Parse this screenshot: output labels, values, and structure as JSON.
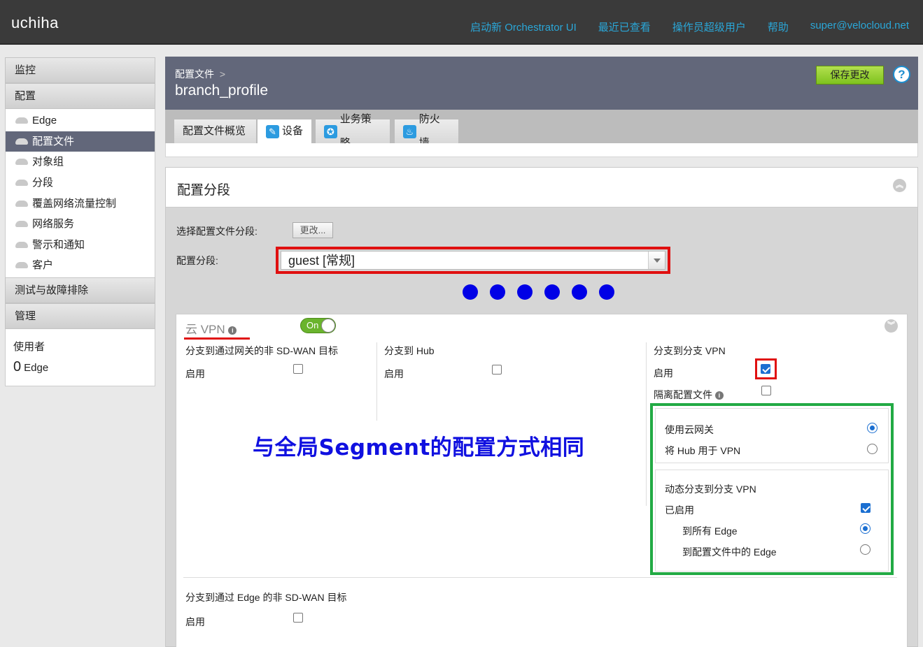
{
  "topbar": {
    "brand": "uchiha",
    "nav": [
      "启动新 Orchestrator UI",
      "最近已查看",
      "操作员超级用户",
      "帮助",
      "super@velocloud.net"
    ]
  },
  "sidebar": {
    "sections": [
      "监控",
      "配置",
      "测试与故障排除",
      "管理"
    ],
    "items": [
      {
        "label": "Edge",
        "icon": "cloud-icon"
      },
      {
        "label": "配置文件",
        "icon": "cloud-icon"
      },
      {
        "label": "对象组",
        "icon": "cloud-icon"
      },
      {
        "label": "分段",
        "icon": "cloud-icon"
      },
      {
        "label": "覆盖网络流量控制",
        "icon": "cloud-icon"
      },
      {
        "label": "网络服务",
        "icon": "cloud-icon"
      },
      {
        "label": "警示和通知",
        "icon": "cloud-icon"
      },
      {
        "label": "客户",
        "icon": "cloud-icon"
      }
    ],
    "user_label": "使用者",
    "edge_count": "0",
    "edge_unit": "Edge"
  },
  "header": {
    "breadcrumb": "配置文件",
    "breadcrumb_sep": ">",
    "title": "branch_profile",
    "save_label": "保存更改",
    "help_label": "?"
  },
  "tabs": [
    {
      "label": "配置文件概览",
      "icon": ""
    },
    {
      "label": "设备",
      "icon": "wrench-icon"
    },
    {
      "label": "业务策略",
      "icon": "ribbon-icon"
    },
    {
      "label": "防火墙",
      "icon": "fire-icon"
    }
  ],
  "panel": {
    "title": "配置分段",
    "select_profile_segment_label": "选择配置文件分段:",
    "change_label": "更改...",
    "segment_label": "配置分段:",
    "segment_value": "guest [常规]",
    "dot_count": 6
  },
  "vpn": {
    "title": "云 VPN",
    "toggle_label": "On",
    "toggle_on": true,
    "col1_title": "分支到通过网关的非 SD-WAN 目标",
    "col1_enable": "启用",
    "col2_title": "分支到 Hub",
    "col2_enable": "启用",
    "col3_title": "分支到分支 VPN",
    "col3_enable": "启用",
    "col3_isolate": "隔离配置文件",
    "use_cloud_gateway": "使用云网关",
    "use_hub_for_vpn": "将 Hub 用于 VPN",
    "dynamic_title": "动态分支到分支 VPN",
    "dynamic_enabled": "已启用",
    "to_all_edges": "到所有 Edge",
    "to_profile_edges": "到配置文件中的 Edge",
    "bottom_title": "分支到通过 Edge 的非 SD-WAN 目标",
    "bottom_enable": "启用",
    "annotation": "与全局Segment的配置方式相同"
  },
  "colors": {
    "accent": "#2aa7d8",
    "header_bg": "#62677a",
    "save_green": "#7ec21e",
    "highlight_red": "#e01010",
    "highlight_green": "#22aa44",
    "annotation_blue": "#1010e0"
  }
}
